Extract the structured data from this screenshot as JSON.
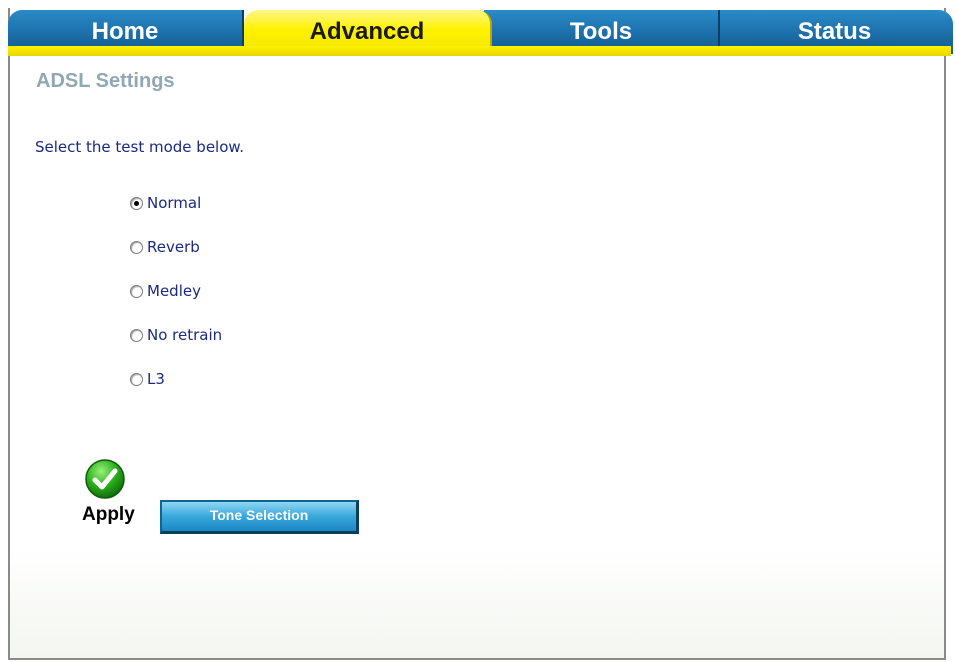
{
  "nav": {
    "tabs": [
      {
        "label": "Home",
        "active": false
      },
      {
        "label": "Advanced",
        "active": true
      },
      {
        "label": "Tools",
        "active": false
      },
      {
        "label": "Status",
        "active": false
      }
    ]
  },
  "page": {
    "title": "ADSL Settings",
    "instruction": "Select the test mode below."
  },
  "test_mode": {
    "selected": "Normal",
    "options": [
      "Normal",
      "Reverb",
      "Medley",
      "No retrain",
      "L3"
    ]
  },
  "actions": {
    "apply_label": "Apply",
    "apply_icon": "check-icon",
    "tone_selection_label": "Tone Selection"
  },
  "colors": {
    "tab_blue": "#1c6ea8",
    "tab_active_yellow": "#fff200",
    "title_gray": "#8fa8b3",
    "text_navy": "#1a2a80",
    "apply_green": "#2bb21c"
  }
}
